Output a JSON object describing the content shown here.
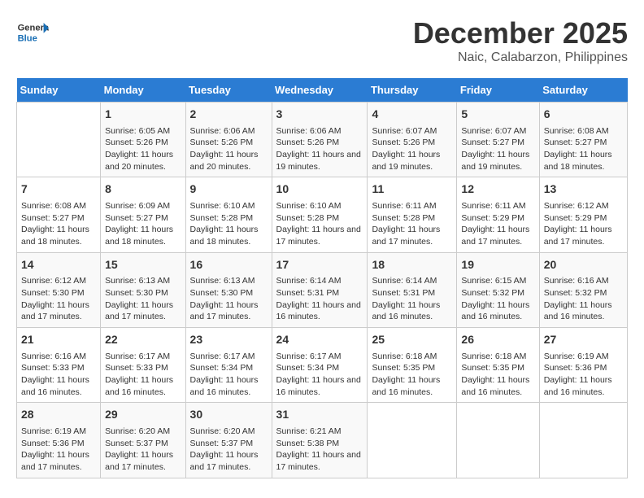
{
  "header": {
    "logo_general": "General",
    "logo_blue": "Blue",
    "main_title": "December 2025",
    "subtitle": "Naic, Calabarzon, Philippines"
  },
  "calendar": {
    "weekdays": [
      "Sunday",
      "Monday",
      "Tuesday",
      "Wednesday",
      "Thursday",
      "Friday",
      "Saturday"
    ],
    "weeks": [
      [
        {
          "day": null
        },
        {
          "day": "1",
          "sunrise": "6:05 AM",
          "sunset": "5:26 PM",
          "daylight": "11 hours and 20 minutes."
        },
        {
          "day": "2",
          "sunrise": "6:06 AM",
          "sunset": "5:26 PM",
          "daylight": "11 hours and 20 minutes."
        },
        {
          "day": "3",
          "sunrise": "6:06 AM",
          "sunset": "5:26 PM",
          "daylight": "11 hours and 19 minutes."
        },
        {
          "day": "4",
          "sunrise": "6:07 AM",
          "sunset": "5:26 PM",
          "daylight": "11 hours and 19 minutes."
        },
        {
          "day": "5",
          "sunrise": "6:07 AM",
          "sunset": "5:27 PM",
          "daylight": "11 hours and 19 minutes."
        },
        {
          "day": "6",
          "sunrise": "6:08 AM",
          "sunset": "5:27 PM",
          "daylight": "11 hours and 18 minutes."
        }
      ],
      [
        {
          "day": "7",
          "sunrise": "6:08 AM",
          "sunset": "5:27 PM",
          "daylight": "11 hours and 18 minutes."
        },
        {
          "day": "8",
          "sunrise": "6:09 AM",
          "sunset": "5:27 PM",
          "daylight": "11 hours and 18 minutes."
        },
        {
          "day": "9",
          "sunrise": "6:10 AM",
          "sunset": "5:28 PM",
          "daylight": "11 hours and 18 minutes."
        },
        {
          "day": "10",
          "sunrise": "6:10 AM",
          "sunset": "5:28 PM",
          "daylight": "11 hours and 17 minutes."
        },
        {
          "day": "11",
          "sunrise": "6:11 AM",
          "sunset": "5:28 PM",
          "daylight": "11 hours and 17 minutes."
        },
        {
          "day": "12",
          "sunrise": "6:11 AM",
          "sunset": "5:29 PM",
          "daylight": "11 hours and 17 minutes."
        },
        {
          "day": "13",
          "sunrise": "6:12 AM",
          "sunset": "5:29 PM",
          "daylight": "11 hours and 17 minutes."
        }
      ],
      [
        {
          "day": "14",
          "sunrise": "6:12 AM",
          "sunset": "5:30 PM",
          "daylight": "11 hours and 17 minutes."
        },
        {
          "day": "15",
          "sunrise": "6:13 AM",
          "sunset": "5:30 PM",
          "daylight": "11 hours and 17 minutes."
        },
        {
          "day": "16",
          "sunrise": "6:13 AM",
          "sunset": "5:30 PM",
          "daylight": "11 hours and 17 minutes."
        },
        {
          "day": "17",
          "sunrise": "6:14 AM",
          "sunset": "5:31 PM",
          "daylight": "11 hours and 16 minutes."
        },
        {
          "day": "18",
          "sunrise": "6:14 AM",
          "sunset": "5:31 PM",
          "daylight": "11 hours and 16 minutes."
        },
        {
          "day": "19",
          "sunrise": "6:15 AM",
          "sunset": "5:32 PM",
          "daylight": "11 hours and 16 minutes."
        },
        {
          "day": "20",
          "sunrise": "6:16 AM",
          "sunset": "5:32 PM",
          "daylight": "11 hours and 16 minutes."
        }
      ],
      [
        {
          "day": "21",
          "sunrise": "6:16 AM",
          "sunset": "5:33 PM",
          "daylight": "11 hours and 16 minutes."
        },
        {
          "day": "22",
          "sunrise": "6:17 AM",
          "sunset": "5:33 PM",
          "daylight": "11 hours and 16 minutes."
        },
        {
          "day": "23",
          "sunrise": "6:17 AM",
          "sunset": "5:34 PM",
          "daylight": "11 hours and 16 minutes."
        },
        {
          "day": "24",
          "sunrise": "6:17 AM",
          "sunset": "5:34 PM",
          "daylight": "11 hours and 16 minutes."
        },
        {
          "day": "25",
          "sunrise": "6:18 AM",
          "sunset": "5:35 PM",
          "daylight": "11 hours and 16 minutes."
        },
        {
          "day": "26",
          "sunrise": "6:18 AM",
          "sunset": "5:35 PM",
          "daylight": "11 hours and 16 minutes."
        },
        {
          "day": "27",
          "sunrise": "6:19 AM",
          "sunset": "5:36 PM",
          "daylight": "11 hours and 16 minutes."
        }
      ],
      [
        {
          "day": "28",
          "sunrise": "6:19 AM",
          "sunset": "5:36 PM",
          "daylight": "11 hours and 17 minutes."
        },
        {
          "day": "29",
          "sunrise": "6:20 AM",
          "sunset": "5:37 PM",
          "daylight": "11 hours and 17 minutes."
        },
        {
          "day": "30",
          "sunrise": "6:20 AM",
          "sunset": "5:37 PM",
          "daylight": "11 hours and 17 minutes."
        },
        {
          "day": "31",
          "sunrise": "6:21 AM",
          "sunset": "5:38 PM",
          "daylight": "11 hours and 17 minutes."
        },
        {
          "day": null
        },
        {
          "day": null
        },
        {
          "day": null
        }
      ]
    ]
  }
}
